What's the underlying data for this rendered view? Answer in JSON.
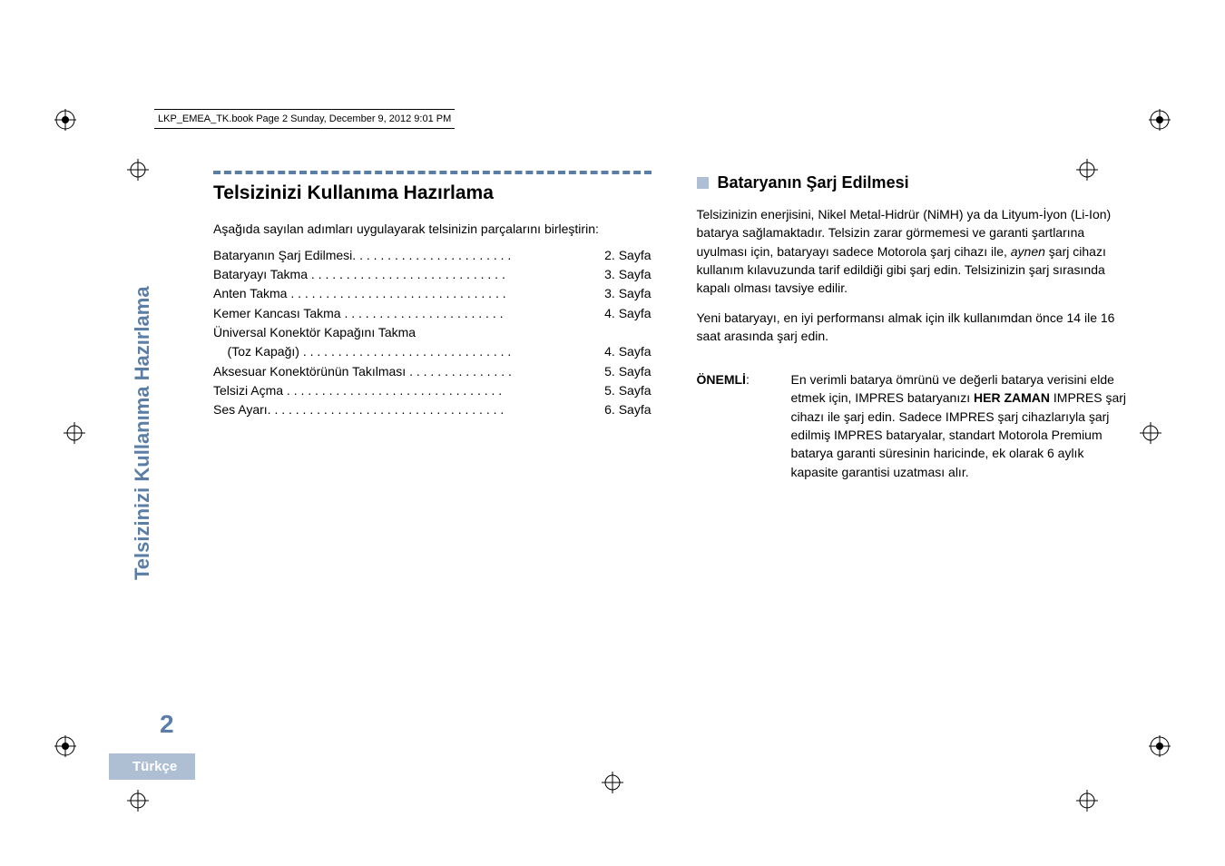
{
  "header": {
    "running_head": "LKP_EMEA_TK.book  Page 2  Sunday, December 9, 2012  9:01 PM"
  },
  "sidebar": {
    "title": "Telsizinizi Kullanıma Hazırlama",
    "page_number": "2",
    "language": "Türkçe"
  },
  "left": {
    "title": "Telsizinizi Kullanıma Hazırlama",
    "intro": "Aşağıda sayılan adımları uygulayarak telsinizin parçalarını birleştirin:",
    "toc": [
      {
        "label": "Bataryanın Şarj Edilmesi. . . . . . . . . . . . . . . . . . . . . . .",
        "page": "2. Sayfa"
      },
      {
        "label": "Bataryayı Takma . . . . . . . . . . . . . . . . . . . . . . . . . . . .",
        "page": "3. Sayfa"
      },
      {
        "label": "Anten Takma . . . . . . . . . . . . . . . . . . . . . . . . . . . . . . .",
        "page": "3. Sayfa"
      },
      {
        "label": "Kemer Kancası Takma . . . . . . . . . . . . . . . . . . . . . . .",
        "page": "4. Sayfa"
      },
      {
        "label": "Üniversal Konektör Kapağını Takma",
        "page": ""
      },
      {
        "label": "    (Toz Kapağı) . . . . . . . . . . . . . . . . . . . . . . . . . . . . . .",
        "page": "4. Sayfa"
      },
      {
        "label": "Aksesuar Konektörünün Takılması . . . . . . . . . . . . . . .",
        "page": "5. Sayfa"
      },
      {
        "label": "Telsizi Açma  . . . . . . . . . . . . . . . . . . . . . . . . . . . . . . .",
        "page": "5. Sayfa"
      },
      {
        "label": "Ses Ayarı. . . . . . . . . . . . . . . . . . . . . . . . . . . . . . . . . .",
        "page": "6. Sayfa"
      }
    ]
  },
  "right": {
    "subtitle": "Bataryanın Şarj Edilmesi",
    "p1a": "Telsizinizin enerjisini, Nikel Metal-Hidrür (NiMH) ya da Lityum-İyon (Li-Ion) batarya sağlamaktadır. Telsizin zarar görmemesi ve garanti şartlarına uyulması için, bataryayı sadece Motorola şarj cihazı ile, ",
    "p1_italic": "aynen",
    "p1b": " şarj cihazı kullanım kılavuzunda tarif edildiği gibi şarj edin. Telsizinizin şarj sırasında kapalı olması tavsiye edilir.",
    "p2": "Yeni bataryayı, en iyi performansı almak için ilk kullanımdan önce 14 ile 16 saat arasında şarj edin.",
    "note_label": "ÖNEMLİ",
    "note_colon": ":",
    "note_a": "En verimli batarya ömrünü ve değerli batarya verisini elde etmek için, IMPRES bataryanızı ",
    "note_bold": "HER ZAMAN",
    "note_b": " IMPRES şarj cihazı ile şarj edin. Sadece IMPRES şarj cihazlarıyla şarj edilmiş IMPRES bataryalar, standart Motorola Premium batarya garanti süresinin haricinde, ek olarak 6 aylık kapasite garantisi uzatması alır."
  }
}
